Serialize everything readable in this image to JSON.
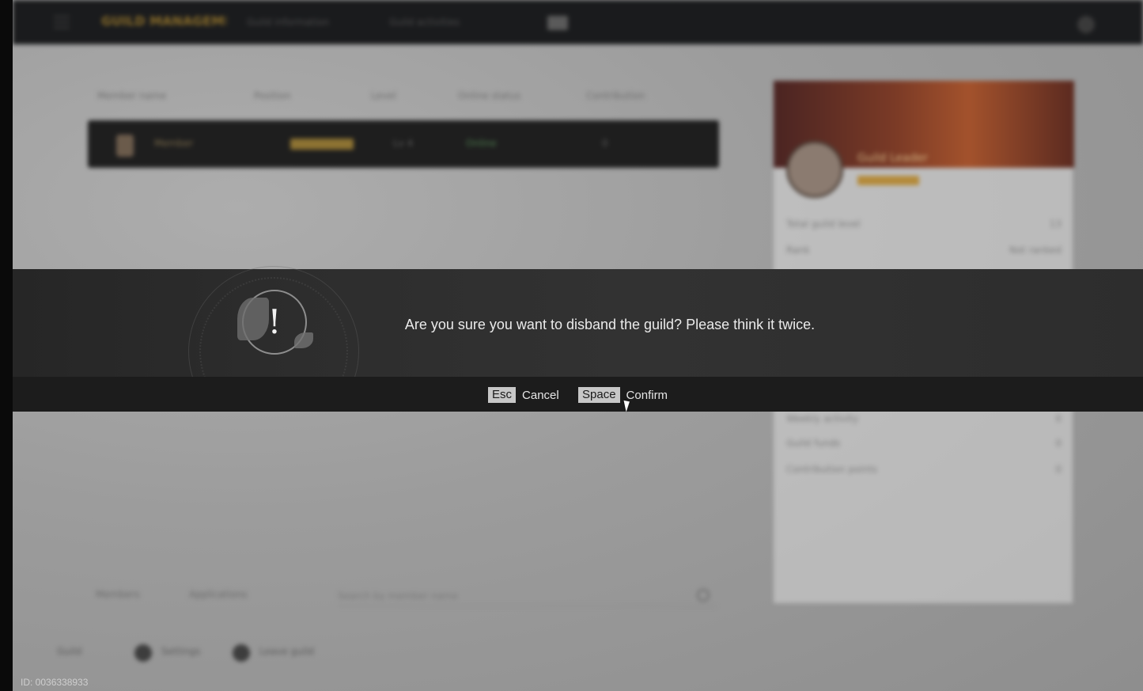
{
  "topbar": {
    "title": "GUILD MANAGEMENT",
    "tab1": "Guild information",
    "tab2": "Guild activities"
  },
  "filters": [
    "Member name",
    "Position",
    "Level",
    "Online status",
    "Contribution"
  ],
  "guild_row": {
    "name": "Member",
    "col1": "Lv 4",
    "col2": "Online",
    "col3": "0"
  },
  "profile_panel": {
    "name": "Guild Leader",
    "rows": [
      {
        "label": "Total guild level",
        "value": "13"
      },
      {
        "label": "Rank",
        "value": "Not ranked"
      },
      {
        "label": "Weekly activity",
        "value": "0"
      },
      {
        "label": "Guild funds",
        "value": "0"
      },
      {
        "label": "Contribution points",
        "value": "0"
      }
    ]
  },
  "bottom_bar": {
    "items": [
      "Members",
      "Applications"
    ],
    "search_placeholder": "Search by member name"
  },
  "actions": [
    "Guild",
    "Settings",
    "Leave guild"
  ],
  "dialog": {
    "message": "Are you sure you want to disband the guild? Please think it twice.",
    "cancel_key": "Esc",
    "cancel_label": "Cancel",
    "confirm_key": "Space",
    "confirm_label": "Confirm"
  },
  "footer": {
    "id_text": "ID: 0036338933"
  }
}
